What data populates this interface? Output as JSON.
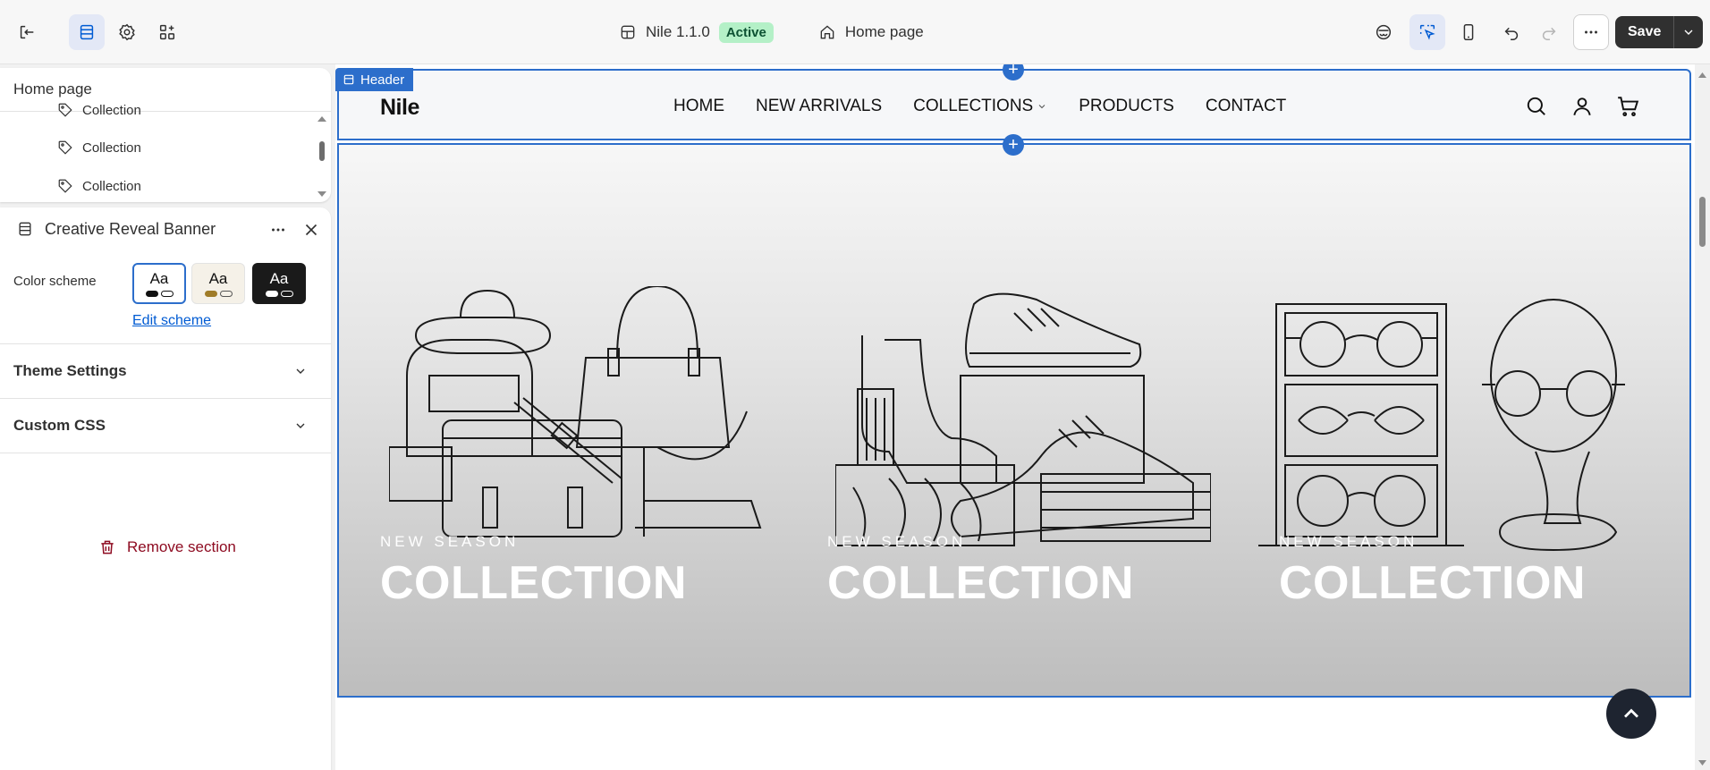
{
  "topbar": {
    "theme_name": "Nile 1.1.0",
    "status_badge": "Active",
    "page_selector": "Home page",
    "save_label": "Save"
  },
  "tree": {
    "title": "Home page",
    "items": [
      "Collection",
      "Collection",
      "Collection"
    ]
  },
  "section": {
    "title": "Creative Reveal Banner",
    "color_scheme_label": "Color scheme",
    "swatch_label": "Aa",
    "edit_scheme": "Edit scheme",
    "accordions": [
      "Theme Settings",
      "Custom CSS"
    ],
    "remove_label": "Remove section"
  },
  "store": {
    "header_tag": "Header",
    "logo": "Nile",
    "nav": [
      "HOME",
      "NEW ARRIVALS",
      "COLLECTIONS",
      "PRODUCTS",
      "CONTACT"
    ]
  },
  "banner": {
    "cards": [
      {
        "eyebrow": "NEW SEASON",
        "title": "COLLECTION",
        "art": "bags-illustration"
      },
      {
        "eyebrow": "NEW SEASON",
        "title": "COLLECTION",
        "art": "shoes-illustration"
      },
      {
        "eyebrow": "NEW SEASON",
        "title": "COLLECTION",
        "art": "glasses-illustration"
      }
    ]
  },
  "colors": {
    "accent": "#2c6ecb",
    "active_badge_bg": "#b4f0c7",
    "remove_text": "#8e0b21"
  }
}
